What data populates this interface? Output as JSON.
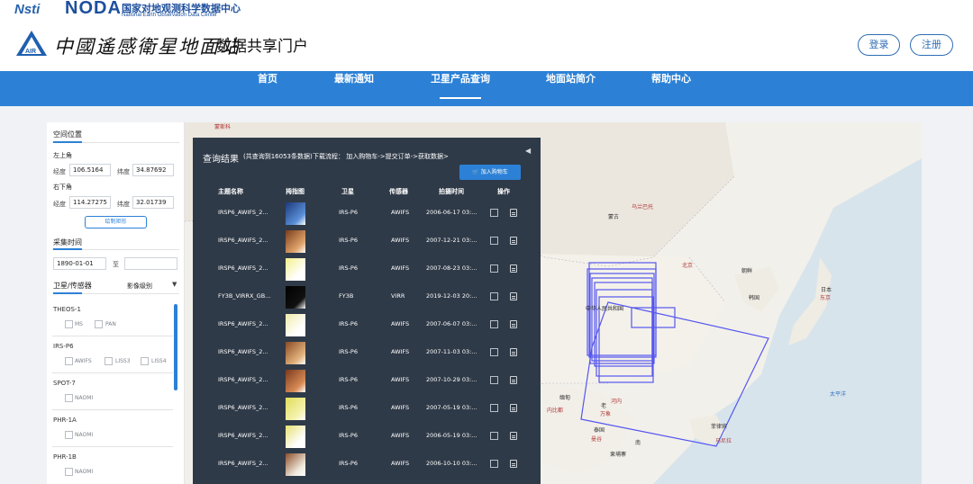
{
  "site": {
    "nsti": "Nsti",
    "noda": "NODA",
    "noda_cn": "国家对地观测科学数据中心",
    "noda_en": "National Earth Observation Data Center",
    "logo_text": "AIR",
    "brand_cn": "中國遙感衛星地面站",
    "portal_name": "数据共享门户",
    "login": "登录",
    "register": "注册"
  },
  "nav": [
    "首页",
    "最新通知",
    "卫星产品查询",
    "地面站简介",
    "帮助中心"
  ],
  "panel": {
    "spatial": "空间位置",
    "top_left": "左上角",
    "bottom_right": "右下角",
    "lng_label": "经度",
    "lat_label": "纬度",
    "tl_lng": "106.5164",
    "tl_lat": "34.87692",
    "br_lng": "114.27275",
    "br_lat": "32.01739",
    "draw_btn": "绘制矩形",
    "time_title": "采集时间",
    "start_date": "1890-01-01",
    "to": "至",
    "end_date": "",
    "sat_title": "卫星/传感器",
    "level_title": "影像级别"
  },
  "satellites": [
    {
      "name": "THEOS-1",
      "sensors": [
        "MS",
        "PAN"
      ]
    },
    {
      "name": "IRS-P6",
      "sensors": [
        "AWIFS",
        "LISS3",
        "LISS4"
      ]
    },
    {
      "name": "SPOT-7",
      "sensors": [
        "NAOMI"
      ]
    },
    {
      "name": "PHR-1A",
      "sensors": [
        "NAOMI"
      ]
    },
    {
      "name": "PHR-1B",
      "sensors": [
        "NAOMI"
      ]
    }
  ],
  "results": {
    "title": "查询结果",
    "count_text": "(共查询到16053条数据)",
    "flow": "下载流程： 加入购物车->提交订单->获取数据>",
    "cart_button": "加入购物车",
    "collapse": "◀",
    "headers": [
      "主题名称",
      "拇指图",
      "卫星",
      "传感器",
      "拍摄时间",
      "操作"
    ],
    "rows": [
      {
        "name": "IRSP6_AWIFS_2...",
        "sat": "IRS-P6",
        "sensor": "AWIFS",
        "time": "2006-06-17 03:..."
      },
      {
        "name": "IRSP6_AWIFS_2...",
        "sat": "IRS-P6",
        "sensor": "AWIFS",
        "time": "2007-12-21 03:..."
      },
      {
        "name": "IRSP6_AWIFS_2...",
        "sat": "IRS-P6",
        "sensor": "AWIFS",
        "time": "2007-08-23 03:..."
      },
      {
        "name": "FY3B_VIRRX_GB...",
        "sat": "FY3B",
        "sensor": "VIRR",
        "time": "2019-12-03 20:..."
      },
      {
        "name": "IRSP6_AWIFS_2...",
        "sat": "IRS-P6",
        "sensor": "AWIFS",
        "time": "2007-06-07 03:..."
      },
      {
        "name": "IRSP6_AWIFS_2...",
        "sat": "IRS-P6",
        "sensor": "AWIFS",
        "time": "2007-11-03 03:..."
      },
      {
        "name": "IRSP6_AWIFS_2...",
        "sat": "IRS-P6",
        "sensor": "AWIFS",
        "time": "2007-10-29 03:..."
      },
      {
        "name": "IRSP6_AWIFS_2...",
        "sat": "IRS-P6",
        "sensor": "AWIFS",
        "time": "2007-05-19 03:..."
      },
      {
        "name": "IRSP6_AWIFS_2...",
        "sat": "IRS-P6",
        "sensor": "AWIFS",
        "time": "2006-05-19 03:..."
      },
      {
        "name": "IRSP6_AWIFS_2...",
        "sat": "IRS-P6",
        "sensor": "AWIFS",
        "time": "2006-10-10 03:..."
      }
    ]
  },
  "map": {
    "labels": {
      "kazakh": "蒙斯科",
      "mongolia": "蒙古",
      "ulaanbaatar": "乌兰巴托",
      "beijing": "北京",
      "korea_n": "朝鲜",
      "korea_s": "韩国",
      "japan": "日本",
      "tokyo": "东京",
      "china": "中华人民共和国",
      "myanmar": "缅甸",
      "naypyidaw": "内比都",
      "laos": "老",
      "vientiane": "万象",
      "hanoi": "河内",
      "thailand": "泰国",
      "bangkok": "曼谷",
      "cambodia": "柬埔寨",
      "philippines": "菲律宾",
      "manila": "马尼拉",
      "pacific": "太平洋",
      "south": "南"
    }
  },
  "colors": {
    "nav": "#2c81d6",
    "panel_dark": "#2f3a48",
    "footprint": "#3a3cf0"
  }
}
